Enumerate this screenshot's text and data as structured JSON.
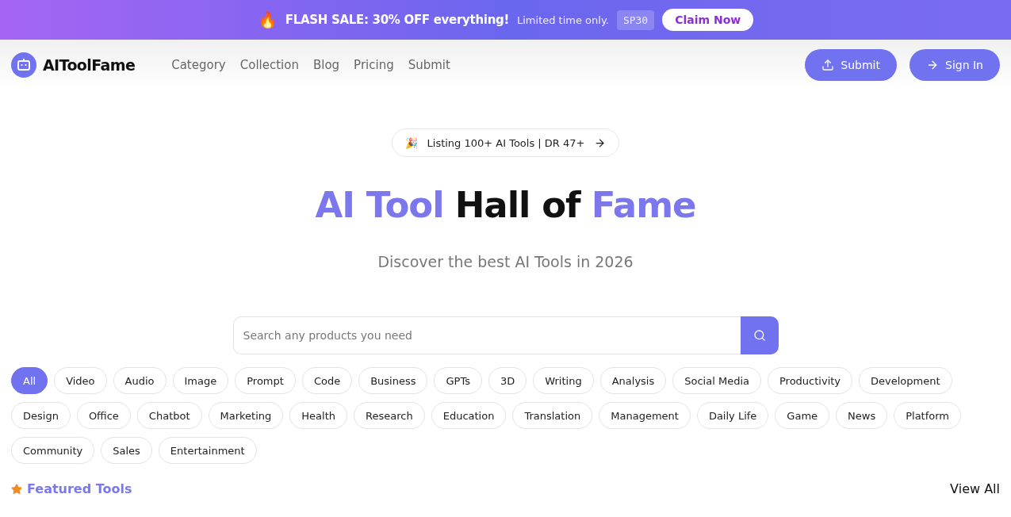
{
  "promo": {
    "emoji": "🔥",
    "headline": "FLASH SALE: 30% OFF everything!",
    "note": "Limited time only.",
    "code": "SP30",
    "button": "Claim Now"
  },
  "nav": {
    "brand": "AIToolFame",
    "links": [
      "Category",
      "Collection",
      "Blog",
      "Pricing",
      "Submit"
    ],
    "submit": "Submit",
    "sign_in": "Sign In"
  },
  "hero": {
    "badge_emoji": "🎉",
    "badge": "Listing 100+ AI Tools | DR 47+",
    "title": [
      {
        "text": "AI Tool",
        "accent": true
      },
      {
        "text": "Hall of",
        "accent": false
      },
      {
        "text": "Fame",
        "accent": true
      }
    ],
    "subtitle": "Discover the best AI Tools in 2026"
  },
  "search": {
    "placeholder": "Search any products you need"
  },
  "categories": [
    {
      "label": "All",
      "selected": true
    },
    {
      "label": "Video",
      "selected": false
    },
    {
      "label": "Audio",
      "selected": false
    },
    {
      "label": "Image",
      "selected": false
    },
    {
      "label": "Prompt",
      "selected": false
    },
    {
      "label": "Code",
      "selected": false
    },
    {
      "label": "Business",
      "selected": false
    },
    {
      "label": "GPTs",
      "selected": false
    },
    {
      "label": "3D",
      "selected": false
    },
    {
      "label": "Writing",
      "selected": false
    },
    {
      "label": "Analysis",
      "selected": false
    },
    {
      "label": "Social Media",
      "selected": false
    },
    {
      "label": "Productivity",
      "selected": false
    },
    {
      "label": "Development",
      "selected": false
    },
    {
      "label": "Design",
      "selected": false
    },
    {
      "label": "Office",
      "selected": false
    },
    {
      "label": "Chatbot",
      "selected": false
    },
    {
      "label": "Marketing",
      "selected": false
    },
    {
      "label": "Health",
      "selected": false
    },
    {
      "label": "Research",
      "selected": false
    },
    {
      "label": "Education",
      "selected": false
    },
    {
      "label": "Translation",
      "selected": false
    },
    {
      "label": "Management",
      "selected": false
    },
    {
      "label": "Daily Life",
      "selected": false
    },
    {
      "label": "Game",
      "selected": false
    },
    {
      "label": "News",
      "selected": false
    },
    {
      "label": "Platform",
      "selected": false
    },
    {
      "label": "Community",
      "selected": false
    },
    {
      "label": "Sales",
      "selected": false
    },
    {
      "label": "Entertainment",
      "selected": false
    }
  ],
  "featured": {
    "title": "Featured Tools",
    "view_all": "View All"
  }
}
